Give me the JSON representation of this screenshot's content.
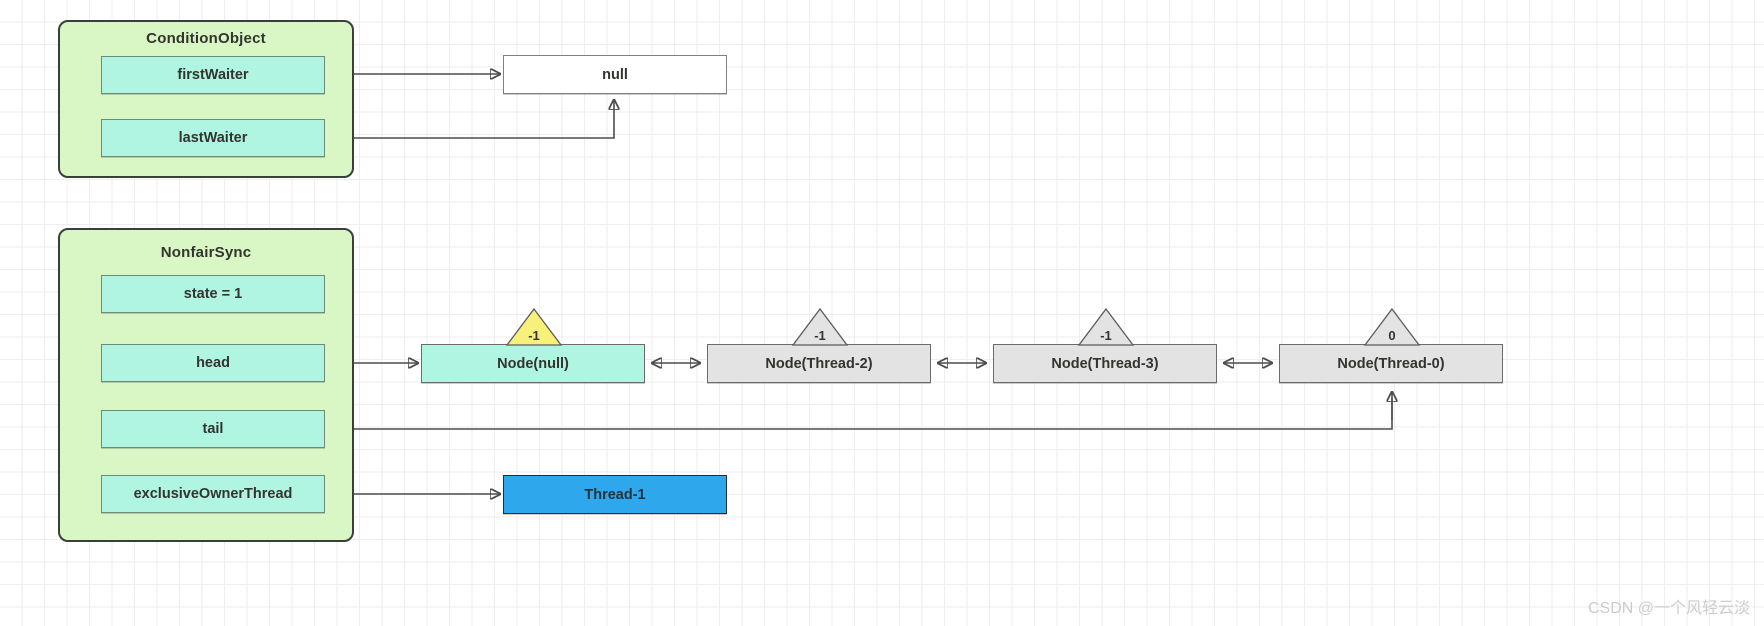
{
  "diagram": {
    "title_hidden": "AQS ReentrantLock state diagram",
    "watermark": "CSDN @一个风轻云淡"
  },
  "colors": {
    "group_fill": "#d9f7c4",
    "group_stroke": "#39403a",
    "field_fill": "#b0f5e2",
    "node_gray_fill": "#e3e3e3",
    "node_cyan_fill": "#b0f5e2",
    "thread_blue_fill": "#2fa7ec",
    "triangle_yellow_fill": "#f7f07a",
    "triangle_gray_fill": "#e3e3e3",
    "connector_stroke": "#4d4d4d",
    "grid_line": "#eeeeee",
    "watermark": "#c9ccd1"
  },
  "condition_object": {
    "title": "ConditionObject",
    "fields": [
      {
        "label": "firstWaiter"
      },
      {
        "label": "lastWaiter"
      }
    ],
    "target": {
      "label": "null"
    }
  },
  "nonfair_sync": {
    "title": "NonfairSync",
    "fields": [
      {
        "label": "state = 1"
      },
      {
        "label": "head"
      },
      {
        "label": "tail"
      },
      {
        "label": "exclusiveOwnerThread"
      }
    ],
    "owner_thread": {
      "label": "Thread-1"
    }
  },
  "queue": {
    "nodes": [
      {
        "label": "Node(null)",
        "wait_status": "-1",
        "fill": "cyan",
        "triangle": "yellow"
      },
      {
        "label": "Node(Thread-2)",
        "wait_status": "-1",
        "fill": "gray",
        "triangle": "gray"
      },
      {
        "label": "Node(Thread-3)",
        "wait_status": "-1",
        "fill": "gray",
        "triangle": "gray"
      },
      {
        "label": "Node(Thread-0)",
        "wait_status": "0",
        "fill": "gray",
        "triangle": "gray"
      }
    ]
  }
}
